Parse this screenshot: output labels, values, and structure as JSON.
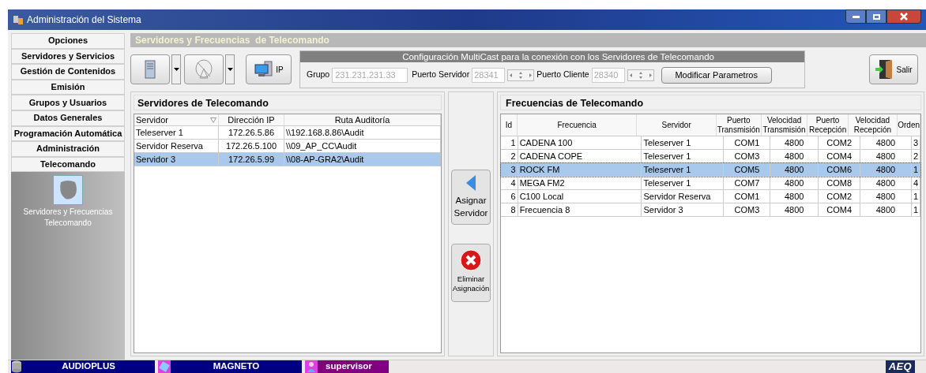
{
  "window": {
    "title": "Administración del Sistema"
  },
  "sidebar": {
    "items": [
      {
        "label": "Opciones"
      },
      {
        "label": "Servidores y Servicios"
      },
      {
        "label": "Gestión de Contenidos"
      },
      {
        "label": "Emisión"
      },
      {
        "label": "Grupos y Usuarios"
      },
      {
        "label": "Datos Generales"
      },
      {
        "label": "Programación Automática"
      },
      {
        "label": "Administración"
      },
      {
        "label": "Telecomando"
      }
    ],
    "panel_item": {
      "label": "Servidores y Frecuencias Telecomando",
      "selected": true
    }
  },
  "page_title": "Servidores y Frecuencias  de Telecomando",
  "toolbar": {
    "ip_button": "IP",
    "multicast": {
      "title": "Configuración MultiCast para la conexión con los Servidores de Telecomando",
      "group_label": "Grupo",
      "group_value": "231.231.231.33",
      "server_port_label": "Puerto Servidor",
      "server_port_value": "28341",
      "client_port_label": "Puerto Cliente",
      "client_port_value": "28340",
      "modify_button": "Modificar Parametros"
    },
    "exit_button": "Salir"
  },
  "servers": {
    "title": "Servidores de Telecomando",
    "columns": [
      "Servidor",
      "Dirección IP",
      "Ruta Auditoría"
    ],
    "rows": [
      {
        "cells": [
          "Teleserver 1",
          "172.26.5.86",
          "\\\\192.168.8.86\\Audit"
        ],
        "selected": false
      },
      {
        "cells": [
          "Servidor Reserva",
          "172.26.5.100",
          "\\\\09_AP_CC\\Audit"
        ],
        "selected": false
      },
      {
        "cells": [
          "Servidor 3",
          "172.26.5.99",
          "\\\\08-AP-GRA2\\Audit"
        ],
        "selected": true
      }
    ]
  },
  "actions": {
    "assign": "Asignar Servidor",
    "remove": "Eliminar Asignación"
  },
  "frequencies": {
    "title": "Frecuencias de Telecomando",
    "columns": [
      "Id",
      "Frecuencia",
      "Servidor",
      "Puerto Transmisión",
      "Velocidad Transmisión",
      "Puerto Recepción",
      "Velocidad Recepción",
      "Orden"
    ],
    "rows": [
      {
        "cells": [
          "1",
          "CADENA 100",
          "Teleserver 1",
          "COM1",
          "4800",
          "COM2",
          "4800",
          "3"
        ],
        "selected": false
      },
      {
        "cells": [
          "2",
          "CADENA COPE",
          "Teleserver 1",
          "COM3",
          "4800",
          "COM4",
          "4800",
          "2"
        ],
        "selected": false
      },
      {
        "cells": [
          "3",
          "ROCK FM",
          "Teleserver 1",
          "COM5",
          "4800",
          "COM6",
          "4800",
          "1"
        ],
        "selected": true
      },
      {
        "cells": [
          "4",
          "MEGA FM2",
          "Teleserver 1",
          "COM7",
          "4800",
          "COM8",
          "4800",
          "4"
        ],
        "selected": false
      },
      {
        "cells": [
          "6",
          "C100 Local",
          "Servidor Reserva",
          "COM1",
          "4800",
          "COM2",
          "4800",
          "1"
        ],
        "selected": false
      },
      {
        "cells": [
          "8",
          "Frecuencia 8",
          "Servidor 3",
          "COM3",
          "4800",
          "COM4",
          "4800",
          "1"
        ],
        "selected": false
      }
    ]
  },
  "status_bar": {
    "items": [
      {
        "label": "AUDIOPLUS",
        "color": "#000080",
        "kind": "database"
      },
      {
        "label": "MAGNETO",
        "color": "#000080",
        "kind": "tape"
      },
      {
        "label": "supervisor",
        "color": "#800080",
        "kind": "user"
      }
    ],
    "logo": "AEQ"
  }
}
